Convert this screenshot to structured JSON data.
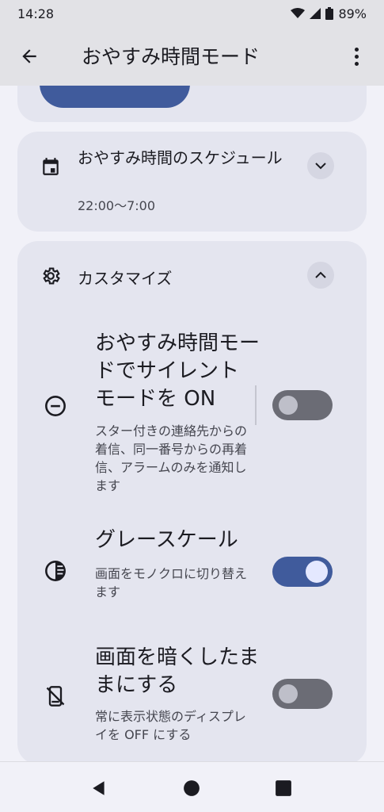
{
  "status": {
    "time": "14:28",
    "battery": "89%"
  },
  "app_bar": {
    "title": "おやすみ時間モード"
  },
  "schedule": {
    "title": "おやすみ時間のスケジュール",
    "subtitle": "22:00〜7:00",
    "expanded": false
  },
  "customize": {
    "title": "カスタマイズ",
    "expanded": true,
    "settings": [
      {
        "title": "おやすみ時間モードでサイレント モードを ON",
        "description": "スター付きの連絡先からの着信、同一番号からの再着信、アラームのみを通知します",
        "enabled": false
      },
      {
        "title": "グレースケール",
        "description": "画面をモノクロに切り替えます",
        "enabled": true
      },
      {
        "title": "画面を暗くしたままにする",
        "description": "常に表示状態のディスプレイを OFF にする",
        "enabled": false
      }
    ]
  },
  "icons": {
    "back": "arrow-left-icon",
    "more": "more-vert-icon",
    "schedule": "calendar-icon",
    "customize": "gear-icon",
    "dnd": "do-not-disturb-icon",
    "grayscale": "contrast-icon",
    "dim": "phone-off-icon"
  },
  "colors": {
    "accent": "#405b9c",
    "toggle_off": "#6b6c75"
  }
}
